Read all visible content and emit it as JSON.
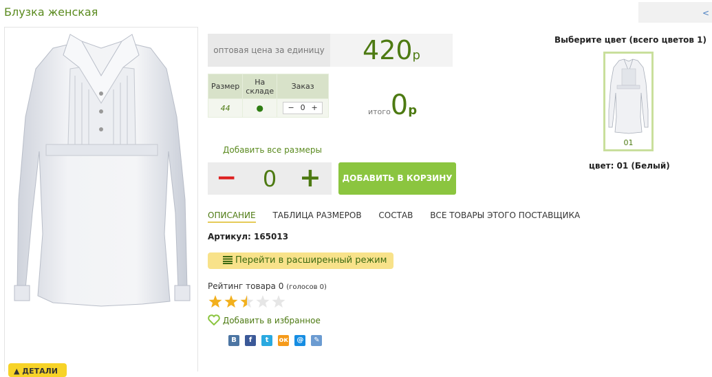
{
  "product": {
    "title": "Блузка женская",
    "collapse_label": "<"
  },
  "price": {
    "label": "оптовая цена за единицу",
    "value": "420",
    "currency": "р"
  },
  "size_table": {
    "headers": [
      "Размер",
      "На складе",
      "Заказ"
    ],
    "rows": [
      {
        "size": "44",
        "stock": "●",
        "qty": "0",
        "minus": "−",
        "plus": "+"
      }
    ]
  },
  "total": {
    "label": "итого",
    "value": "0",
    "currency": "р"
  },
  "add_all": {
    "label": "Добавить все размеры",
    "minus": "−",
    "qty": "0",
    "plus": "+"
  },
  "cart_button": "ДОБАВИТЬ В КОРЗИНУ",
  "tabs": [
    "ОПИСАНИЕ",
    "ТАБЛИЦА РАЗМЕРОВ",
    "СОСТАВ",
    "ВСЕ ТОВАРЫ ЭТОГО ПОСТАВЩИКА"
  ],
  "article": "Артикул: 165013",
  "expand_button": "Перейти в расширенный режим",
  "rating": {
    "text": "Рейтинг товара 0",
    "votes": "(голосов 0)",
    "stars_filled": 2.5,
    "stars_total": 5
  },
  "favorite": "Добавить в избранное",
  "share_icons": [
    "vk-icon",
    "facebook-icon",
    "twitter-icon",
    "odnoklassniki-icon",
    "mailru-icon",
    "livejournal-icon"
  ],
  "share_glyphs": [
    "В",
    "f",
    "t",
    "ок",
    "@",
    "✎"
  ],
  "colors": {
    "title": "Выберите цвет (всего цветов 1)",
    "items": [
      {
        "code": "01"
      }
    ],
    "selected": "цвет: 01 (Белый)"
  },
  "more_button": "▲ ДЕТАЛИ",
  "palette": {
    "accent_green": "#8bc53f",
    "text_green": "#4d7a12",
    "minus_red": "#dd1f1f",
    "button_yellow": "#f7d327"
  }
}
